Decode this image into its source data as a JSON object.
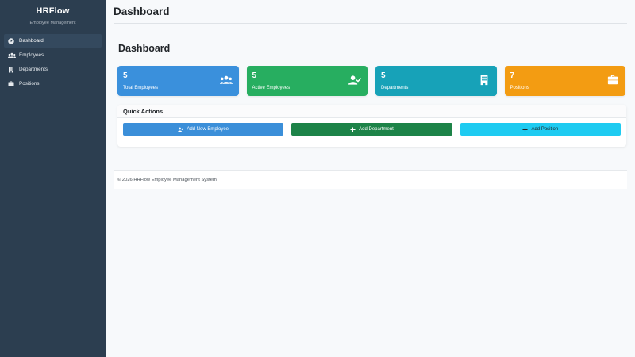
{
  "sidebar": {
    "brand_title": "HRFlow",
    "brand_subtitle": "Employee Management",
    "items": [
      {
        "label": "Dashboard",
        "icon": "dashboard-icon",
        "active": true
      },
      {
        "label": "Employees",
        "icon": "users-icon"
      },
      {
        "label": "Departments",
        "icon": "building-icon"
      },
      {
        "label": "Positions",
        "icon": "briefcase-icon"
      }
    ]
  },
  "header": {
    "title": "Dashboard"
  },
  "main": {
    "page_title": "Dashboard",
    "stats": [
      {
        "value": "5",
        "label": "Total Employees",
        "icon": "users-icon",
        "color": "#3a90dc"
      },
      {
        "value": "5",
        "label": "Active Employees",
        "icon": "user-check-icon",
        "color": "#27ae60"
      },
      {
        "value": "5",
        "label": "Departments",
        "icon": "building-icon",
        "color": "#17a2b8"
      },
      {
        "value": "7",
        "label": "Positions",
        "icon": "briefcase-icon",
        "color": "#f39c12"
      }
    ],
    "quick_actions": {
      "title": "Quick Actions",
      "buttons": [
        {
          "label": "Add New Employee",
          "icon": "user-plus-icon",
          "color": "#3b8fd9"
        },
        {
          "label": "Add Department",
          "icon": "plus-icon",
          "color": "#1d8348"
        },
        {
          "label": "Add Position",
          "icon": "plus-icon",
          "color": "#1ecbf1"
        }
      ]
    }
  },
  "footer": {
    "text": "© 2026 HRFlow Employee Management System"
  }
}
